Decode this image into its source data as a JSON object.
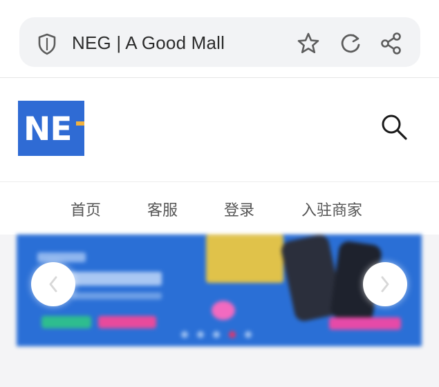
{
  "browser": {
    "url_title": "NEG | A Good Mall",
    "icons": [
      "shield-icon",
      "star-icon",
      "refresh-icon",
      "share-icon"
    ]
  },
  "site": {
    "logo_text": "NE",
    "brand_color": "#2f6bd4",
    "accent_color": "#f2b23e"
  },
  "nav": {
    "items": [
      "首页",
      "客服",
      "登录",
      "入驻商家"
    ]
  },
  "banner": {
    "dot_count": 5,
    "active_dot_index": 3
  }
}
